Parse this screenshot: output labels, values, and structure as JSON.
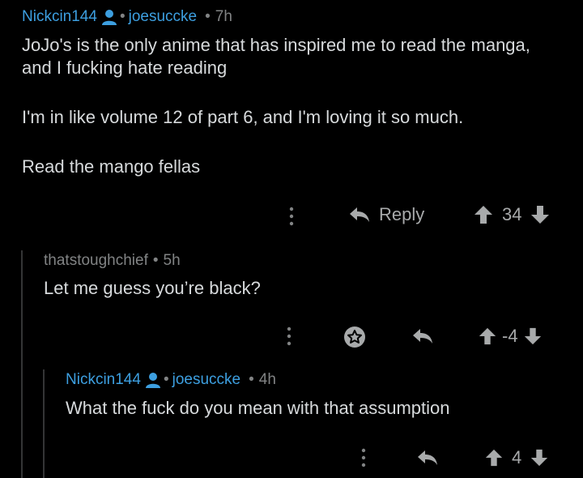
{
  "comments": [
    {
      "author": "Nickcin144",
      "flair": "joesuccke",
      "separator": "•",
      "age": "7h",
      "paragraphs": [
        "JoJo's is the only anime that has inspired me to read the manga, and I fucking hate reading",
        "I'm in like volume 12 of part 6, and I'm loving it so much.",
        "Read the mango fellas"
      ],
      "reply_label": "Reply",
      "score": "34"
    },
    {
      "author": "thatstoughchief",
      "separator": "•",
      "age": "5h",
      "paragraphs": [
        "Let me guess you’re black?"
      ],
      "score": "-4"
    },
    {
      "author": "Nickcin144",
      "flair": "joesuccke",
      "separator": "•",
      "age": "4h",
      "paragraphs": [
        "What the fuck do you mean with that assumption"
      ],
      "score": "4"
    }
  ],
  "colors": {
    "background": "#000000",
    "op_accent": "#3d9fe0",
    "text": "#d7dadc",
    "muted": "#818384",
    "thread_line": "#343536"
  }
}
